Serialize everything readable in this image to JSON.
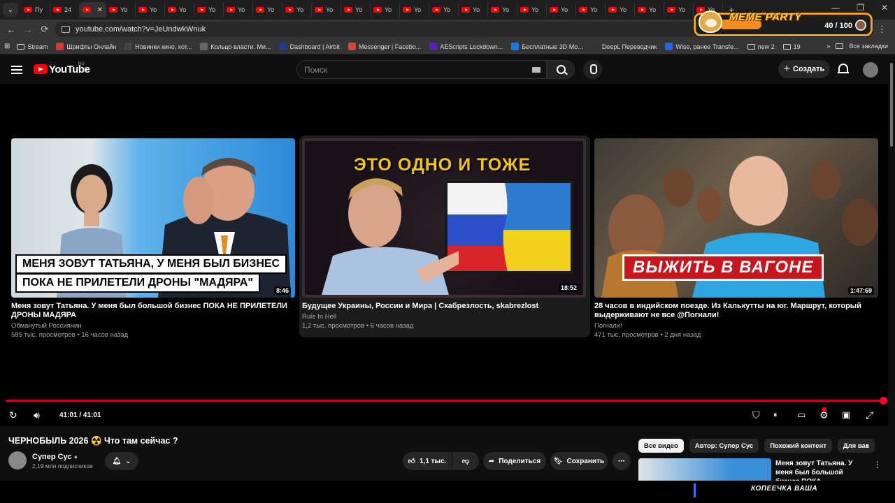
{
  "browser": {
    "tabs": [
      {
        "label": "Пу"
      },
      {
        "label": "24"
      },
      {
        "label": ""
      },
      {
        "label": "Yo"
      },
      {
        "label": "Yo"
      },
      {
        "label": "Yo"
      },
      {
        "label": "Yo"
      },
      {
        "label": "Yo"
      },
      {
        "label": "Yo"
      },
      {
        "label": "Yo"
      },
      {
        "label": "Yo"
      },
      {
        "label": "Yo"
      },
      {
        "label": "Yo"
      },
      {
        "label": "Yo"
      },
      {
        "label": "Yo"
      },
      {
        "label": "Yo"
      },
      {
        "label": "Yo"
      },
      {
        "label": "Yo"
      },
      {
        "label": "Yo"
      },
      {
        "label": "Yo"
      },
      {
        "label": "Yo"
      },
      {
        "label": "Yo"
      },
      {
        "label": "Yo"
      },
      {
        "label": "Yo"
      }
    ],
    "url": "youtube.com/watch?v=JeUndwkWnuk",
    "bookmarks": [
      "Stream",
      "Шрифты Онлайн",
      "Новинки кино, кот...",
      "Кольцо власти. Ми...",
      "Dashboard | Airbit",
      "Messenger | Facebo...",
      "AEScripts Lockdown...",
      "Бесплатные 3D Мо...",
      "DeepL Переводчик",
      "Wise, ранее Transfe...",
      "new 2",
      "19"
    ],
    "all_bookmarks": "Все закладки"
  },
  "meme_widget": {
    "title": "MEME PARTY",
    "count": "40 / 100",
    "progress_fraction": 0.4
  },
  "header": {
    "logo": "YouTube",
    "region": "RU",
    "search_placeholder": "Поиск",
    "create_label": "Создать"
  },
  "endscreen": {
    "cards": [
      {
        "caption_lines": [
          "МЕНЯ ЗОВУТ ТАТЬЯНА, У МЕНЯ БЫЛ БИЗНЕС",
          "ПОКА НЕ ПРИЛЕТЕЛИ ДРОНЫ \"МАДЯРА\""
        ],
        "duration": "8:46",
        "title": "Меня зовут Татьяна. У меня был большой бизнес ПОКА НЕ ПРИЛЕТЕЛИ ДРОНЫ МАДЯРА",
        "channel": "Обманутый Россиянин",
        "meta": "585 тыс. просмотров • 16 часов назад"
      },
      {
        "caption": "ЭТО ОДНО И ТОЖЕ",
        "duration": "18:52",
        "title": "Будущее Украины, России и Мира | Скабрезлость, skabrezlost",
        "channel": "Rule In Hell",
        "meta": "1,2 тыс. просмотров • 6 часов назад"
      },
      {
        "caption": "ВЫЖИТЬ В ВАГОНЕ",
        "duration": "1:47:69",
        "title": "28 часов в индийском поезде. Из Калькутты на юг. Маршрут, который выдерживают не все @Погнали!",
        "channel": "Погнали!",
        "meta": "471 тыс. просмотров • 2 дня назад"
      }
    ]
  },
  "player": {
    "time": "41:01 / 41:01",
    "progress_fraction": 1.0
  },
  "video": {
    "title": "ЧЕРНОБЫЛЬ 2026 ☢️ Что там сейчас ?",
    "channel": "Супер Сус",
    "subscribers": "2,19 млн подписчиков",
    "likes": "1,1 тыс.",
    "share_label": "Поделиться",
    "save_label": "Сохранить"
  },
  "sidebar": {
    "chips": [
      "Все видео",
      "Автор: Супер Сус",
      "Похожий контент",
      "Для вас"
    ],
    "first_related_title": "Меня зовут Татьяна. У меня был большой бизнес ПОКА ..."
  },
  "taskbar": {
    "overlay_text": "КОПЕЕЧКА ВАША"
  }
}
